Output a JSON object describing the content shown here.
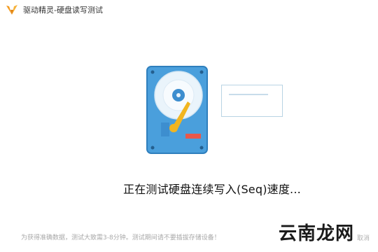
{
  "window": {
    "title": "驱动精灵-硬盘读写测试"
  },
  "main": {
    "status": "正在测试硬盘连续写入(Seq)速度...",
    "tip": "为获得准确数据，测试大致需3-8分钟。测试期间请不要插拔存储设备！",
    "cancel_label": "取消"
  },
  "watermark": {
    "text": "云南龙网"
  },
  "icons": {
    "app_logo": "bird-logo-icon",
    "illustration": "hard-disk-icon"
  },
  "colors": {
    "logo_orange": "#f39a1e",
    "disk_blue": "#4a9fdc",
    "disk_border": "#2f7fbd",
    "pointer_yellow": "#f1b520",
    "chip_red": "#e8574a"
  }
}
